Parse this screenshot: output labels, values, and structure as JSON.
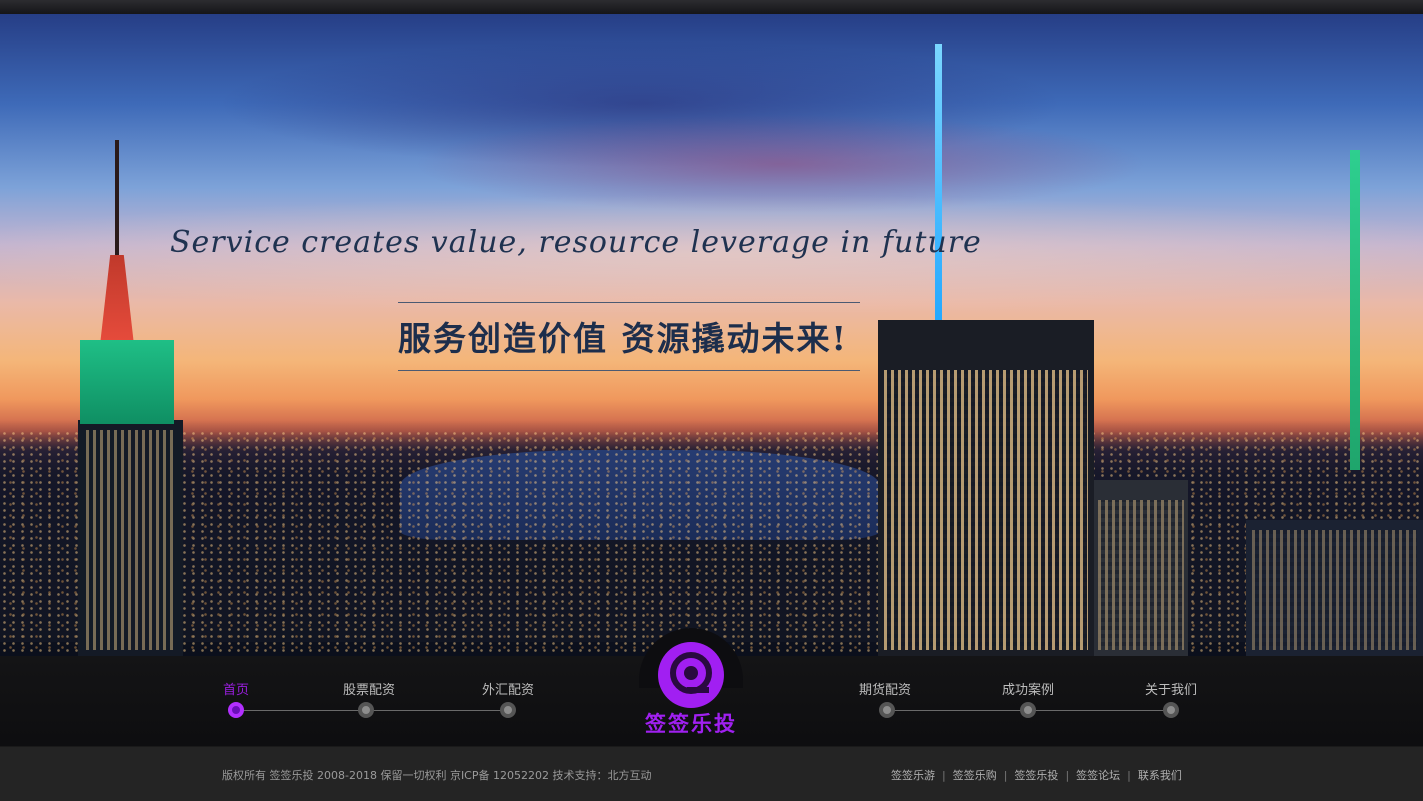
{
  "hero": {
    "slogan_en": "Service creates value, resource leverage in future",
    "slogan_cn": "服务创造价值  资源撬动未来!"
  },
  "nav": {
    "items": [
      {
        "label": "首页",
        "active": true
      },
      {
        "label": "股票配资",
        "active": false
      },
      {
        "label": "外汇配资",
        "active": false
      },
      {
        "label": "期货配资",
        "active": false
      },
      {
        "label": "成功案例",
        "active": false
      },
      {
        "label": "关于我们",
        "active": false
      }
    ],
    "logo_text": "签签乐投",
    "accent_color": "#9b1ee0"
  },
  "footer": {
    "copyright": "版权所有  签签乐投  2008-2018  保留一切权利  京ICP备 12052202   技术支持：北方互动",
    "links": [
      "签签乐游",
      "签签乐购",
      "签签乐投",
      "签签论坛",
      "联系我们"
    ],
    "separator": "|"
  }
}
